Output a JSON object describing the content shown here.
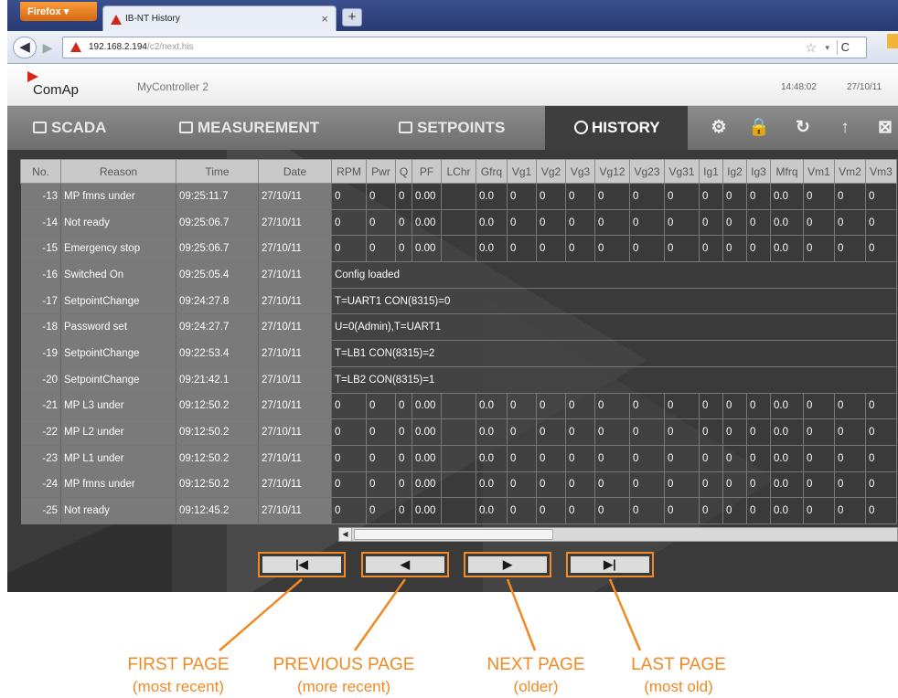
{
  "browser": {
    "app_button": "Firefox ▾",
    "tab_title": "IB-NT History",
    "new_tab": "+",
    "url_host": "192.168.2.194",
    "url_path": "/c2/next.his"
  },
  "header": {
    "logo_text": "ComAp",
    "controller": "MyController 2",
    "time": "14:48:02",
    "date": "27/10/11"
  },
  "menu": {
    "scada": "SCADA",
    "measurement": "MEASUREMENT",
    "setpoints": "SETPOINTS",
    "history": "HISTORY"
  },
  "table": {
    "columns": [
      "No.",
      "Reason",
      "Time",
      "Date",
      "RPM",
      "Pwr",
      "Q",
      "PF",
      "LChr",
      "Gfrq",
      "Vg1",
      "Vg2",
      "Vg3",
      "Vg12",
      "Vg23",
      "Vg31",
      "Ig1",
      "Ig2",
      "Ig3",
      "Mfrq",
      "Vm1",
      "Vm2",
      "Vm3"
    ],
    "rows": [
      {
        "no": "-13",
        "reason": "MP fmns under",
        "time": "09:25:11.7",
        "date": "27/10/11",
        "values": [
          "0",
          "0",
          "0",
          "0.00",
          "",
          "0.0",
          "0",
          "0",
          "0",
          "0",
          "0",
          "0",
          "0",
          "0",
          "0",
          "0.0",
          "0",
          "0",
          "0"
        ]
      },
      {
        "no": "-14",
        "reason": "Not ready",
        "time": "09:25:06.7",
        "date": "27/10/11",
        "values": [
          "0",
          "0",
          "0",
          "0.00",
          "",
          "0.0",
          "0",
          "0",
          "0",
          "0",
          "0",
          "0",
          "0",
          "0",
          "0",
          "0.0",
          "0",
          "0",
          "0"
        ]
      },
      {
        "no": "-15",
        "reason": "Emergency stop",
        "time": "09:25:06.7",
        "date": "27/10/11",
        "values": [
          "0",
          "0",
          "0",
          "0.00",
          "",
          "0.0",
          "0",
          "0",
          "0",
          "0",
          "0",
          "0",
          "0",
          "0",
          "0",
          "0.0",
          "0",
          "0",
          "0"
        ]
      },
      {
        "no": "-16",
        "reason": "Switched On",
        "time": "09:25:05.4",
        "date": "27/10/11",
        "text": "Config loaded"
      },
      {
        "no": "-17",
        "reason": "SetpointChange",
        "time": "09:24:27.8",
        "date": "27/10/11",
        "text": "T=UART1 CON(8315)=0"
      },
      {
        "no": "-18",
        "reason": "Password set",
        "time": "09:24:27.7",
        "date": "27/10/11",
        "text": "U=0(Admin),T=UART1"
      },
      {
        "no": "-19",
        "reason": "SetpointChange",
        "time": "09:22:53.4",
        "date": "27/10/11",
        "text": "T=LB1 CON(8315)=2"
      },
      {
        "no": "-20",
        "reason": "SetpointChange",
        "time": "09:21:42.1",
        "date": "27/10/11",
        "text": "T=LB2 CON(8315)=1"
      },
      {
        "no": "-21",
        "reason": "MP L3 under",
        "time": "09:12:50.2",
        "date": "27/10/11",
        "values": [
          "0",
          "0",
          "0",
          "0.00",
          "",
          "0.0",
          "0",
          "0",
          "0",
          "0",
          "0",
          "0",
          "0",
          "0",
          "0",
          "0.0",
          "0",
          "0",
          "0"
        ]
      },
      {
        "no": "-22",
        "reason": "MP L2 under",
        "time": "09:12:50.2",
        "date": "27/10/11",
        "values": [
          "0",
          "0",
          "0",
          "0.00",
          "",
          "0.0",
          "0",
          "0",
          "0",
          "0",
          "0",
          "0",
          "0",
          "0",
          "0",
          "0.0",
          "0",
          "0",
          "0"
        ]
      },
      {
        "no": "-23",
        "reason": "MP L1 under",
        "time": "09:12:50.2",
        "date": "27/10/11",
        "values": [
          "0",
          "0",
          "0",
          "0.00",
          "",
          "0.0",
          "0",
          "0",
          "0",
          "0",
          "0",
          "0",
          "0",
          "0",
          "0",
          "0.0",
          "0",
          "0",
          "0"
        ]
      },
      {
        "no": "-24",
        "reason": "MP fmns under",
        "time": "09:12:50.2",
        "date": "27/10/11",
        "values": [
          "0",
          "0",
          "0",
          "0.00",
          "",
          "0.0",
          "0",
          "0",
          "0",
          "0",
          "0",
          "0",
          "0",
          "0",
          "0",
          "0.0",
          "0",
          "0",
          "0"
        ]
      },
      {
        "no": "-25",
        "reason": "Not ready",
        "time": "09:12:45.2",
        "date": "27/10/11",
        "values": [
          "0",
          "0",
          "0",
          "0.00",
          "",
          "0.0",
          "0",
          "0",
          "0",
          "0",
          "0",
          "0",
          "0",
          "0",
          "0",
          "0.0",
          "0",
          "0",
          "0"
        ]
      }
    ]
  },
  "pager": {
    "first": "|◀",
    "prev": "◀",
    "next": "▶",
    "last": "▶|"
  },
  "callouts": {
    "first_title": "FIRST PAGE",
    "first_sub": "(most recent)",
    "prev_title": "PREVIOUS PAGE",
    "prev_sub": "(more recent)",
    "next_title": "NEXT PAGE",
    "next_sub": "(older)",
    "last_title": "LAST PAGE",
    "last_sub": "(most old)"
  },
  "colors": {
    "accent": "#f08a24",
    "menu_bg": "#7d7d7d",
    "active_tab": "#3e3e3e",
    "brand_red": "#d6281b"
  }
}
